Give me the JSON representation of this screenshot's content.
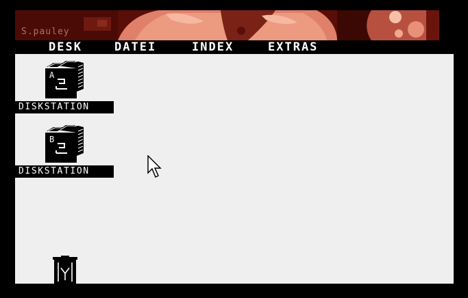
{
  "banner": {
    "signature": "S.pauley"
  },
  "menubar": {
    "items": [
      {
        "label": "DESK"
      },
      {
        "label": "DATEI"
      },
      {
        "label": "INDEX"
      },
      {
        "label": "EXTRAS"
      }
    ]
  },
  "desktop": {
    "drives": [
      {
        "letter": "A",
        "label": "DISKSTATION",
        "icon": "file-drawer-icon"
      },
      {
        "letter": "B",
        "label": "DISKSTATION",
        "icon": "file-drawer-icon"
      }
    ],
    "trash": {
      "icon": "trash-can-icon"
    }
  },
  "colors": {
    "desktop_bg": "#efefef",
    "menubar_bg": "#000000",
    "menubar_text": "#ffffff",
    "banner_dark": "#5a0e08",
    "banner_skin": "#e0806a"
  }
}
